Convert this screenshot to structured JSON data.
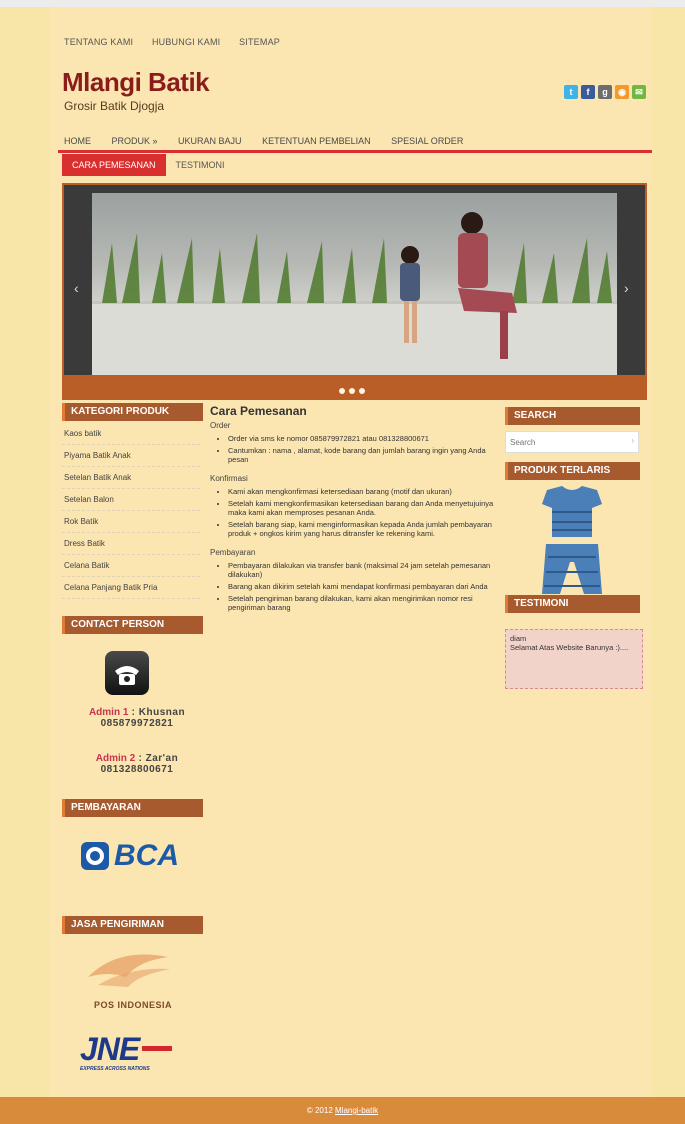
{
  "top_nav": [
    "TENTANG KAMI",
    "HUBUNGI KAMI",
    "SITEMAP"
  ],
  "site": {
    "title": "Mlangi Batik",
    "tagline": "Grosir Batik Djogja"
  },
  "social_icons": [
    "twitter-icon",
    "facebook-icon",
    "google-plus-icon",
    "rss-icon",
    "email-icon"
  ],
  "main_nav": [
    "HOME",
    "PRODUK »",
    "UKURAN BAJU",
    "KETENTUAN PEMBELIAN",
    "SPESIAL ORDER"
  ],
  "sub_nav": {
    "active": "CARA PEMESANAN",
    "other": "TESTIMONI"
  },
  "slider": {
    "prev": "‹",
    "next": "›"
  },
  "kategori": {
    "title": "KATEGORI PRODUK",
    "items": [
      "Kaos batik",
      "Piyama Batik Anak",
      "Setelan Batik Anak",
      "Setelan Balon",
      "Rok Batik",
      "Dress Batik",
      "Celana Batik",
      "Celana Panjang Batik Pria"
    ]
  },
  "contact": {
    "title": "CONTACT PERSON",
    "admin1_label": "Admin 1",
    "admin1_name": " : Khusnan",
    "admin1_phone": "085879972821",
    "admin2_label": "Admin 2",
    "admin2_name": " : Zar'an",
    "admin2_phone": "081328800671"
  },
  "pembayaran": {
    "title": "PEMBAYARAN",
    "bank": "BCA"
  },
  "jasa": {
    "title": "JASA PENGIRIMAN",
    "pos": "POS INDONESIA",
    "jne": "JNE",
    "jne_tag": "EXPRESS ACROSS NATIONS"
  },
  "main": {
    "title": "Cara Pemesanan",
    "sections": [
      {
        "heading": "Order",
        "items": [
          "Order via sms ke nomor 085879972821 atau 081328800671",
          "Cantumkan : nama , alamat, kode barang dan jumlah barang ingin yang Anda pesan"
        ]
      },
      {
        "heading": "Konfirmasi",
        "items": [
          "Kami akan mengkonfirmasi ketersediaan barang (motif dan ukuran)",
          "Setelah kami mengkonfirmasikan ketersediaan barang dan Anda menyetujuinya maka kami akan memproses pesanan Anda.",
          "Setelah barang siap, kami menginformasikan kepada Anda jumlah pembayaran produk + ongkos kirim yang harus ditransfer ke rekening kami."
        ]
      },
      {
        "heading": "Pembayaran",
        "items": [
          "Pembayaran dilakukan via transfer bank (maksimal 24 jam setelah pemesanan dilakukan)",
          "Barang akan dikirim setelah kami mendapat konfirmasi pembayaran dari Anda",
          "Setelah pengiriman barang dilakukan, kami akan mengirimkan nomor resi pengiriman barang"
        ]
      }
    ]
  },
  "search": {
    "title": "SEARCH",
    "placeholder": "Search"
  },
  "produk_terlaris": {
    "title": "PRODUK TERLARIS"
  },
  "testimoni": {
    "title": "TESTIMONI",
    "author": "diam",
    "text": "Selamat Atas Website Barunya :)...."
  },
  "footer": {
    "copyright": "© 2012 ",
    "link": "Mlangi-batik"
  }
}
